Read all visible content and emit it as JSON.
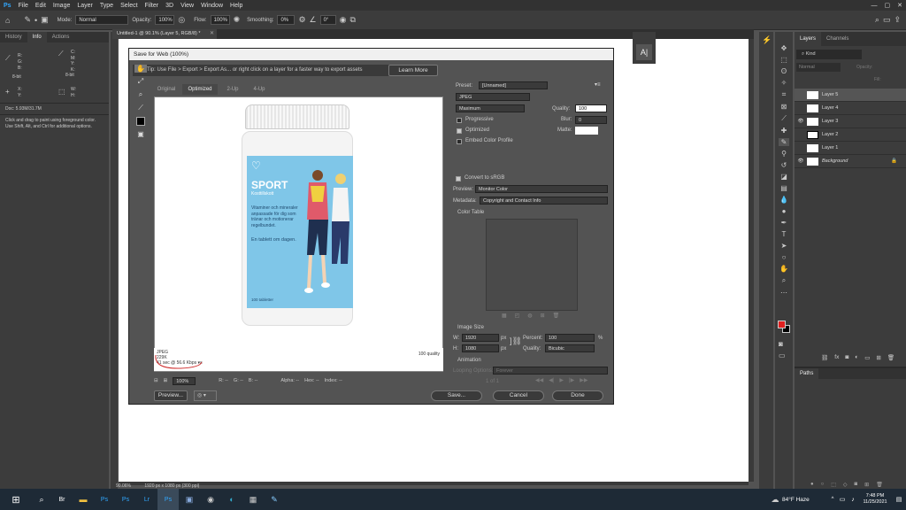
{
  "menu": [
    "File",
    "Edit",
    "Image",
    "Layer",
    "Type",
    "Select",
    "Filter",
    "3D",
    "View",
    "Window",
    "Help"
  ],
  "options": {
    "mode_label": "Mode:",
    "mode": "Normal",
    "opacity_label": "Opacity:",
    "opacity": "100%",
    "flow_label": "Flow:",
    "flow": "100%",
    "smoothing_label": "Smoothing:",
    "smoothing": "0%",
    "angle": "0°"
  },
  "left_panel": {
    "tabs": [
      "History",
      "Info",
      "Actions"
    ],
    "r": "R:",
    "g": "G:",
    "b": "B:",
    "c": "C:",
    "m": "M:",
    "y": "Y:",
    "k": "K:",
    "bit1": "8-bit",
    "bit2": "8-bit",
    "x": "X:",
    "yy": "Y:",
    "w": "W:",
    "h": "H:",
    "doc": "Doc: 5.93M/31.7M",
    "hint": "Click and drag to paint using foreground color.  Use Shift, Alt, and Ctrl for additional options."
  },
  "doc_tab": "Untitled-1 @ 90.1% (Layer 5, RGB/8) *",
  "dialog": {
    "title": "Save for Web (100%)",
    "tip": "Tip: Use File > Export > Export As...  or right click on a layer for a faster way to export assets",
    "learn_more": "Learn More",
    "tabs": [
      "Original",
      "Optimized",
      "2-Up",
      "4-Up"
    ],
    "preset_label": "Preset:",
    "preset": "[Unnamed]",
    "format": "JPEG",
    "quality_mode": "Maximum",
    "quality_label": "Quality:",
    "quality": "100",
    "progressive": "Progressive",
    "blur_label": "Blur:",
    "blur": "0",
    "optimized": "Optimized",
    "matte_label": "Matte:",
    "embed": "Embed Color Profile",
    "convert": "Convert to sRGB",
    "preview_label": "Preview:",
    "preview_val": "Monitor Color",
    "metadata_label": "Metadata:",
    "metadata_val": "Copyright and Contact Info",
    "color_table": "Color Table",
    "image_size": "Image Size",
    "w_label": "W:",
    "w": "1920",
    "h_label": "H:",
    "h": "1080",
    "px": "px",
    "percent_label": "Percent:",
    "percent": "100",
    "pct": "%",
    "quality2_label": "Quality:",
    "quality2": "Bicubic",
    "animation": "Animation",
    "looping_label": "Looping Options:",
    "looping": "Forever",
    "frame": "1 of 1",
    "info_format": "JPEG",
    "info_size": "229K",
    "info_time": "41 sec @ 56.6 Kbps",
    "info_quality": "100 quality",
    "zoom": "100%",
    "rlabel": "R: --",
    "glabel": "G: --",
    "blabel": "B: --",
    "alpha": "Alpha: --",
    "hex": "Hex: --",
    "index": "Index: --",
    "preview_btn": "Preview...",
    "save": "Save...",
    "cancel": "Cancel",
    "done": "Done"
  },
  "product": {
    "brand": "SPORT",
    "sub": "Kosttillskott",
    "desc": "Vitaminer och mineraler anpassade för dig som tränar och motionerar regelbundet.",
    "dose": "En tablett om dagen.",
    "count": "100 tabletter"
  },
  "layers": {
    "tabs": [
      "Layers",
      "Channels"
    ],
    "kind": "Kind",
    "mode": "Normal",
    "opacity_label": "Opacity:",
    "fill_label": "Fill:",
    "items": [
      "Layer 5",
      "Layer 4",
      "Layer 3",
      "Layer 2",
      "Layer 1",
      "Background"
    ],
    "paths": "Paths"
  },
  "status": {
    "zoom": "90.06%",
    "dims": "1920 px x 1080 px (300 ppi)"
  },
  "taskbar": {
    "weather": "84°F  Haze",
    "time": "7:48 PM",
    "date": "11/25/2021"
  }
}
